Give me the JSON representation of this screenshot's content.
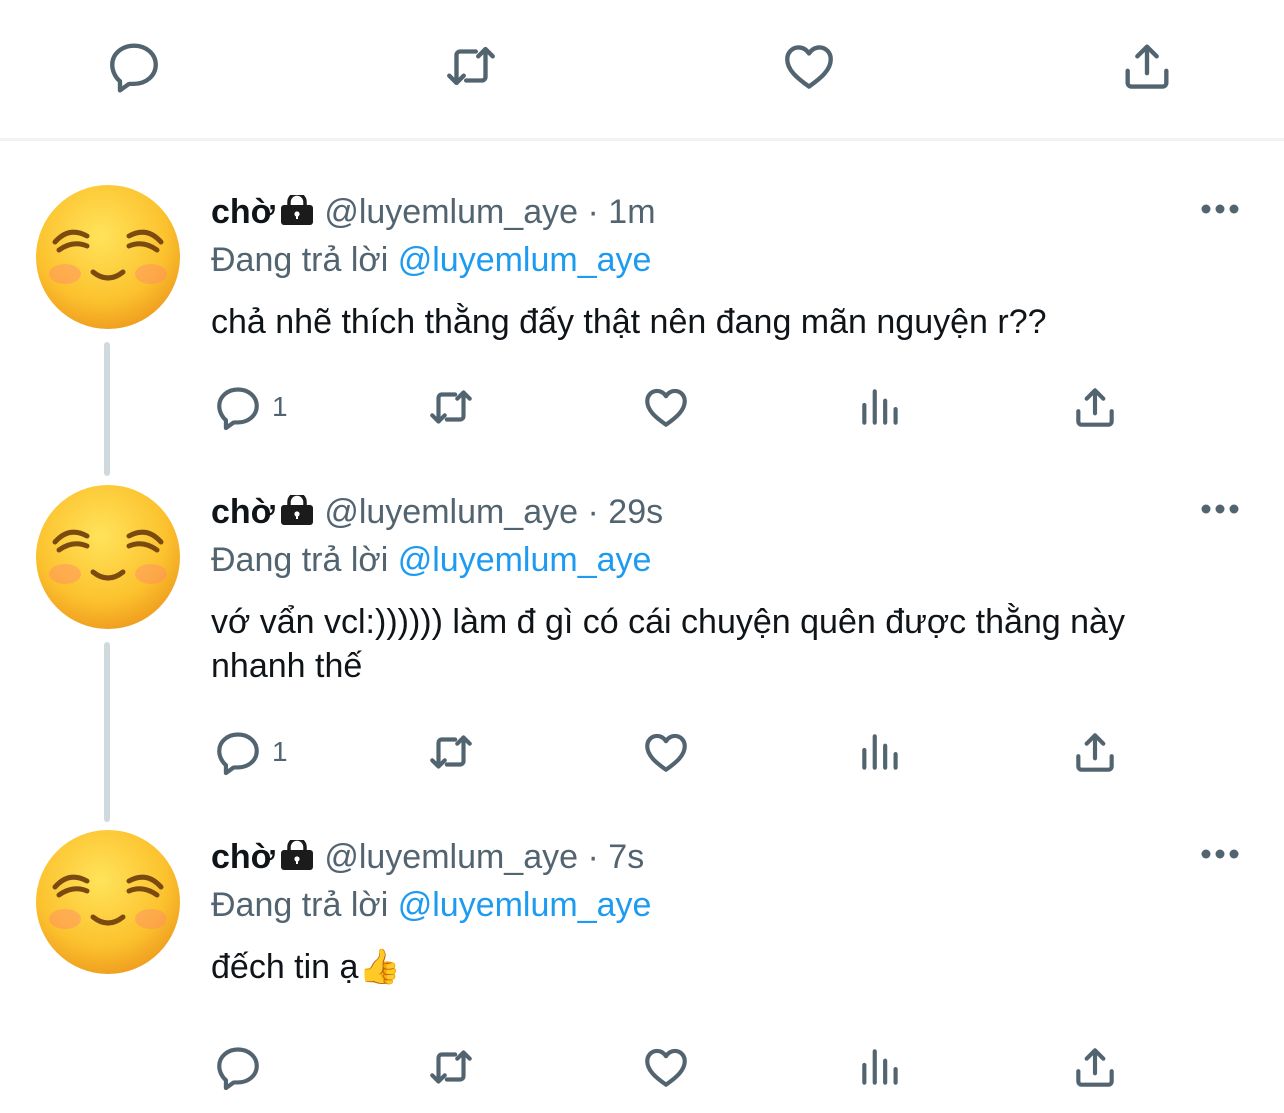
{
  "colors": {
    "text_primary": "#0f1419",
    "text_secondary": "#536471",
    "link": "#1d9bf0",
    "divider": "#eff3f4",
    "thread_line": "#cfd9de"
  },
  "top_actions": [
    {
      "name": "reply",
      "icon": "comment-icon"
    },
    {
      "name": "retweet",
      "icon": "retweet-icon"
    },
    {
      "name": "like",
      "icon": "heart-icon"
    },
    {
      "name": "share",
      "icon": "share-icon"
    }
  ],
  "replies": [
    {
      "name": "chờ",
      "handle": "@luyemlum_aye",
      "separator": "·",
      "time": "1m",
      "replying_prefix": "Đang trả lời",
      "replying_to": "@luyemlum_aye",
      "text": "chả nhẽ thích thằng đấy thật nên đang mãn nguyện r??",
      "reply_count": "1",
      "emoji": "😊"
    },
    {
      "name": "chờ",
      "handle": "@luyemlum_aye",
      "separator": "·",
      "time": "29s",
      "replying_prefix": "Đang trả lời",
      "replying_to": "@luyemlum_aye",
      "text": "vớ vẩn vcl:)))))) làm đ gì có cái chuyện quên được thằng này nhanh thế",
      "reply_count": "1",
      "emoji": "😊"
    },
    {
      "name": "chờ",
      "handle": "@luyemlum_aye",
      "separator": "·",
      "time": "7s",
      "replying_prefix": "Đang trả lời",
      "replying_to": "@luyemlum_aye",
      "text": "đếch tin ạ👍",
      "reply_count": "",
      "emoji": "😊"
    }
  ]
}
